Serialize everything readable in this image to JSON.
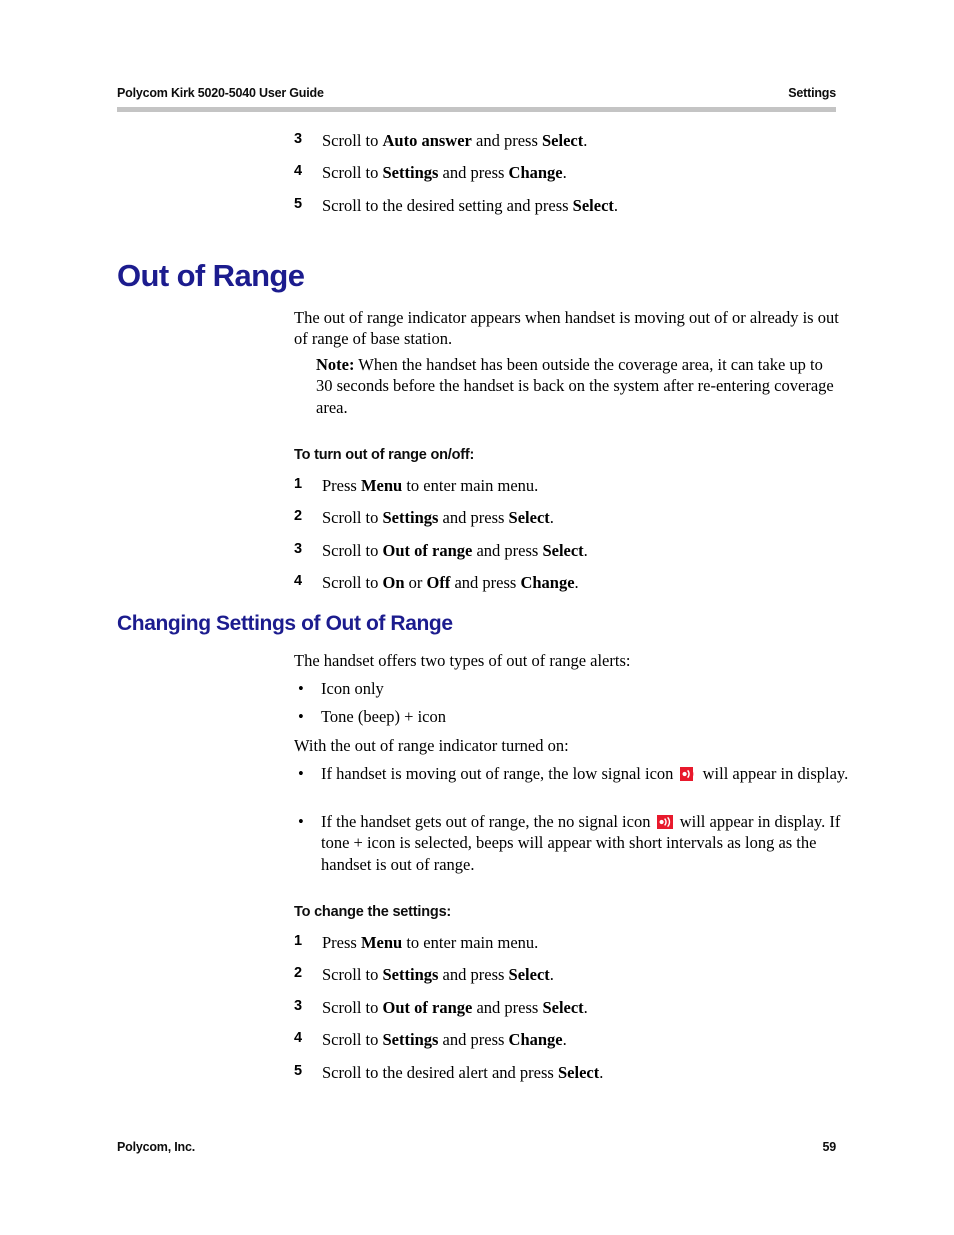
{
  "header": {
    "left": "Polycom Kirk 5020-5040 User Guide",
    "right": "Settings"
  },
  "footer": {
    "left": "Polycom, Inc.",
    "page_number": "59"
  },
  "colors": {
    "heading_blue": "#1c1c8e",
    "header_rule_gray": "#c4c4c4",
    "icon_red": "#e8192c",
    "text_black": "#000000"
  },
  "top_steps": [
    {
      "num": "3",
      "parts": [
        {
          "t": "Scroll to ",
          "b": false
        },
        {
          "t": "Auto answer",
          "b": true
        },
        {
          "t": " and press ",
          "b": false
        },
        {
          "t": "Select",
          "b": true
        },
        {
          "t": ".",
          "b": false
        }
      ]
    },
    {
      "num": "4",
      "parts": [
        {
          "t": "Scroll to ",
          "b": false
        },
        {
          "t": "Settings",
          "b": true
        },
        {
          "t": " and press ",
          "b": false
        },
        {
          "t": "Change",
          "b": true
        },
        {
          "t": ".",
          "b": false
        }
      ]
    },
    {
      "num": "5",
      "parts": [
        {
          "t": "Scroll to the desired setting and press ",
          "b": false
        },
        {
          "t": "Select",
          "b": true
        },
        {
          "t": ".",
          "b": false
        }
      ]
    }
  ],
  "section_out_of_range": {
    "heading": "Out of Range",
    "intro": "The out of range indicator appears when handset is moving out of or already is out of range of base station.",
    "note_label": "Note:",
    "note_body": " When the handset has been outside the coverage area, it can take up to 30 seconds before the handset is back on the system after re-entering coverage area.",
    "procedure_title": "To turn out of range on/off:",
    "steps": [
      {
        "num": "1",
        "parts": [
          {
            "t": "Press ",
            "b": false
          },
          {
            "t": "Menu",
            "b": true
          },
          {
            "t": " to enter main menu.",
            "b": false
          }
        ]
      },
      {
        "num": "2",
        "parts": [
          {
            "t": "Scroll to ",
            "b": false
          },
          {
            "t": "Settings",
            "b": true
          },
          {
            "t": " and press ",
            "b": false
          },
          {
            "t": "Select",
            "b": true
          },
          {
            "t": ".",
            "b": false
          }
        ]
      },
      {
        "num": "3",
        "parts": [
          {
            "t": "Scroll to ",
            "b": false
          },
          {
            "t": "Out of range",
            "b": true
          },
          {
            "t": " and press ",
            "b": false
          },
          {
            "t": "Select",
            "b": true
          },
          {
            "t": ".",
            "b": false
          }
        ]
      },
      {
        "num": "4",
        "parts": [
          {
            "t": "Scroll to ",
            "b": false
          },
          {
            "t": "On",
            "b": true
          },
          {
            "t": " or ",
            "b": false
          },
          {
            "t": "Off",
            "b": true
          },
          {
            "t": " and press ",
            "b": false
          },
          {
            "t": "Change",
            "b": true
          },
          {
            "t": ".",
            "b": false
          }
        ]
      }
    ]
  },
  "section_changing_settings": {
    "heading": "Changing Settings of Out of Range",
    "intro": "The handset offers two types of out of range alerts:",
    "alert_types": [
      "Icon only",
      "Tone (beep) + icon"
    ],
    "lead_in": "With the out of range indicator turned on:",
    "icon_bullets": [
      {
        "pre": "If handset is moving out of range, the low signal icon",
        "icon": "low-signal-icon",
        "post": "will appear in display."
      },
      {
        "pre": "If the handset gets out of range, the no signal icon",
        "icon": "no-signal-icon",
        "post": "will appear in display. If tone + icon is selected, beeps will appear with short intervals as long as the handset is out of range."
      }
    ],
    "procedure_title": "To change the settings:",
    "steps": [
      {
        "num": "1",
        "parts": [
          {
            "t": "Press ",
            "b": false
          },
          {
            "t": "Menu",
            "b": true
          },
          {
            "t": " to enter main menu.",
            "b": false
          }
        ]
      },
      {
        "num": "2",
        "parts": [
          {
            "t": "Scroll to ",
            "b": false
          },
          {
            "t": "Settings",
            "b": true
          },
          {
            "t": " and press ",
            "b": false
          },
          {
            "t": "Select",
            "b": true
          },
          {
            "t": ".",
            "b": false
          }
        ]
      },
      {
        "num": "3",
        "parts": [
          {
            "t": "Scroll to ",
            "b": false
          },
          {
            "t": "Out of range",
            "b": true
          },
          {
            "t": " and press ",
            "b": false
          },
          {
            "t": "Select",
            "b": true
          },
          {
            "t": ".",
            "b": false
          }
        ]
      },
      {
        "num": "4",
        "parts": [
          {
            "t": "Scroll to ",
            "b": false
          },
          {
            "t": "Settings",
            "b": true
          },
          {
            "t": " and press ",
            "b": false
          },
          {
            "t": "Change",
            "b": true
          },
          {
            "t": ".",
            "b": false
          }
        ]
      },
      {
        "num": "5",
        "parts": [
          {
            "t": "Scroll to the desired alert and press ",
            "b": false
          },
          {
            "t": "Select",
            "b": true
          },
          {
            "t": ".",
            "b": false
          }
        ]
      }
    ]
  },
  "bullet_glyph": "•"
}
